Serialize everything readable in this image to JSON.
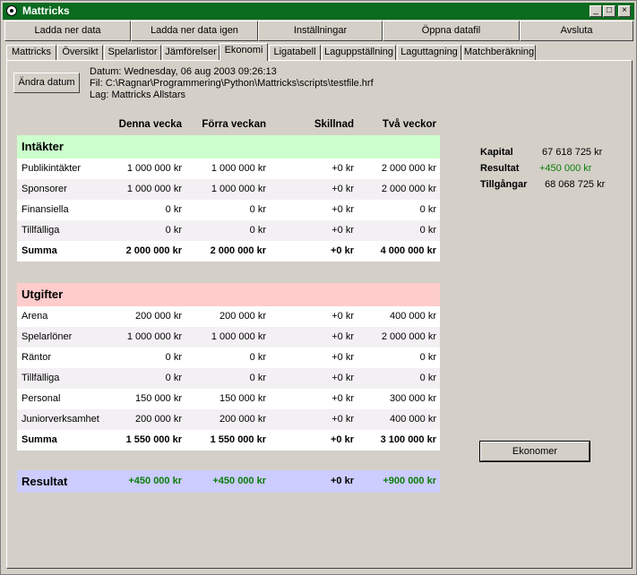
{
  "window": {
    "title": "Mattricks"
  },
  "toolbar": [
    "Ladda ner data",
    "Ladda ner data igen",
    "Inställningar",
    "Öppna datafil",
    "Avsluta"
  ],
  "tabs": [
    "Mattricks",
    "Översikt",
    "Spelarlistor",
    "Jämförelser",
    "Ekonomi",
    "Ligatabell",
    "Laguppställning",
    "Laguttagning",
    "Matchberäkning"
  ],
  "active_tab": "Ekonomi",
  "change_date_button": "Ändra datum",
  "info": {
    "date": "Datum: Wednesday, 06 aug 2003 09:26:13",
    "file": "Fil: C:\\Ragnar\\Programmering\\Python\\Mattricks\\scripts\\testfile.hrf",
    "team": "Lag: Mattricks Allstars"
  },
  "columns": [
    "Denna vecka",
    "Förra veckan",
    "Skillnad",
    "Två veckor"
  ],
  "income": {
    "title": "Intäkter",
    "rows": [
      {
        "label": "Publikintäkter",
        "values": [
          "1 000 000 kr",
          "1 000 000 kr",
          "+0 kr",
          "2 000 000 kr"
        ]
      },
      {
        "label": "Sponsorer",
        "values": [
          "1 000 000 kr",
          "1 000 000 kr",
          "+0 kr",
          "2 000 000 kr"
        ]
      },
      {
        "label": "Finansiella",
        "values": [
          "0 kr",
          "0 kr",
          "+0 kr",
          "0 kr"
        ]
      },
      {
        "label": "Tillfälliga",
        "values": [
          "0 kr",
          "0 kr",
          "+0 kr",
          "0 kr"
        ]
      }
    ],
    "sum": {
      "label": "Summa",
      "values": [
        "2 000 000 kr",
        "2 000 000 kr",
        "+0 kr",
        "4 000 000 kr"
      ]
    }
  },
  "expenses": {
    "title": "Utgifter",
    "rows": [
      {
        "label": "Arena",
        "values": [
          "200 000 kr",
          "200 000 kr",
          "+0 kr",
          "400 000 kr"
        ]
      },
      {
        "label": "Spelarlöner",
        "values": [
          "1 000 000 kr",
          "1 000 000 kr",
          "+0 kr",
          "2 000 000 kr"
        ]
      },
      {
        "label": "Räntor",
        "values": [
          "0 kr",
          "0 kr",
          "+0 kr",
          "0 kr"
        ]
      },
      {
        "label": "Tillfälliga",
        "values": [
          "0 kr",
          "0 kr",
          "+0 kr",
          "0 kr"
        ]
      },
      {
        "label": "Personal",
        "values": [
          "150 000 kr",
          "150 000 kr",
          "+0 kr",
          "300 000 kr"
        ]
      },
      {
        "label": "Juniorverksamhet",
        "values": [
          "200 000 kr",
          "200 000 kr",
          "+0 kr",
          "400 000 kr"
        ]
      }
    ],
    "sum": {
      "label": "Summa",
      "values": [
        "1 550 000 kr",
        "1 550 000 kr",
        "+0 kr",
        "3 100 000 kr"
      ]
    }
  },
  "result": {
    "label": "Resultat",
    "values": [
      "+450 000 kr",
      "+450 000 kr",
      "+0 kr",
      "+900 000 kr"
    ]
  },
  "summary": [
    {
      "label": "Kapital",
      "value": "67 618 725 kr"
    },
    {
      "label": "Resultat",
      "value": "+450 000 kr"
    },
    {
      "label": "Tillgångar",
      "value": "68 068 725 kr"
    }
  ],
  "economist_button": "Ekonomer",
  "colors": {
    "titlebar": "#0b6b1f",
    "income_header": "#ccffcc",
    "expense_header": "#ffcccc",
    "result_row": "#ccccff",
    "positive": "#0a7d0a"
  }
}
